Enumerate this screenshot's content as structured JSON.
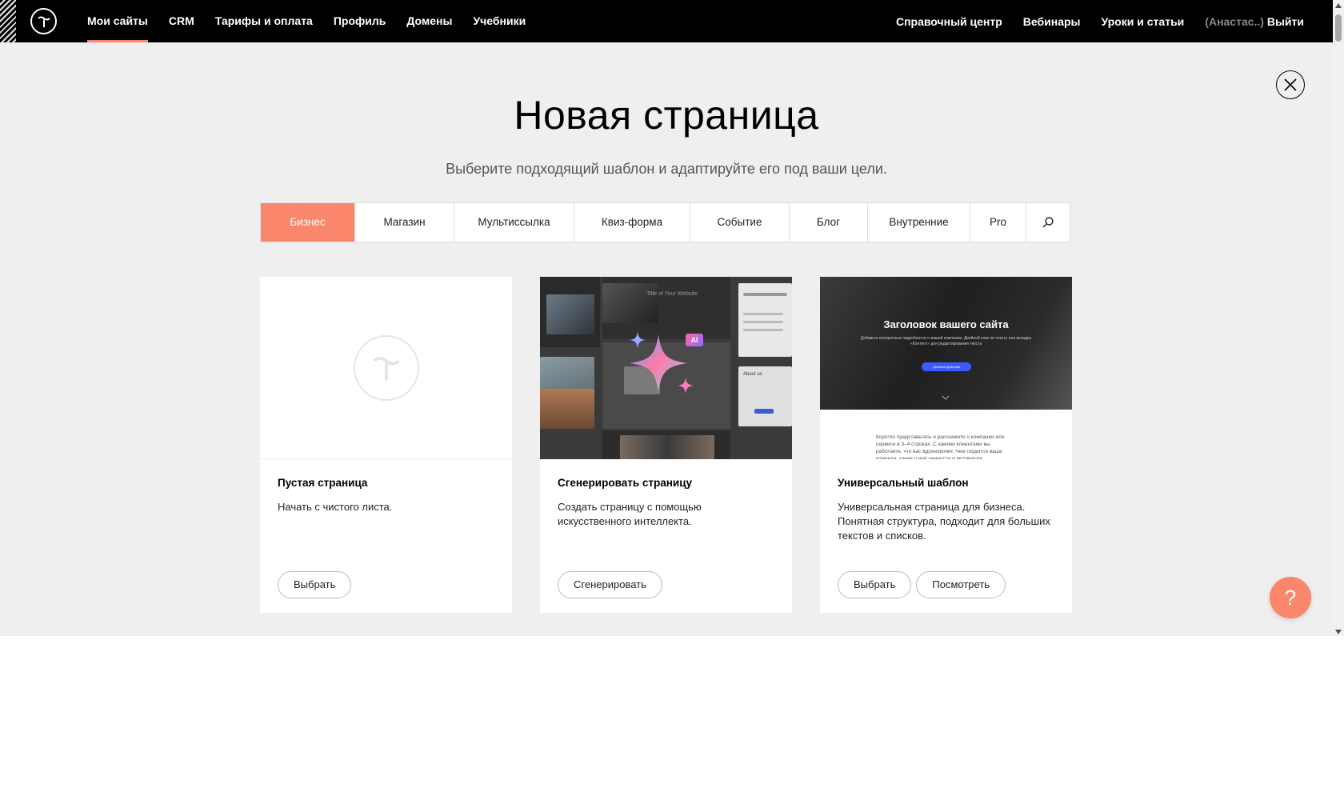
{
  "nav": {
    "left": [
      "Мои сайты",
      "CRM",
      "Тарифы и оплата",
      "Профиль",
      "Домены",
      "Учебники"
    ],
    "active_index": 0,
    "right": [
      "Справочный центр",
      "Вебинары",
      "Уроки и статьи"
    ],
    "user": "(Анастас..)",
    "logout": "Выйти"
  },
  "modal": {
    "title": "Новая страница",
    "subtitle": "Выберите подходящий шаблон и адаптируйте его под ваши цели.",
    "tabs": [
      "Бизнес",
      "Магазин",
      "Мультиссылка",
      "Квиз-форма",
      "Событие",
      "Блог",
      "Внутренние",
      "Pro"
    ],
    "active_tab": 0
  },
  "cards": [
    {
      "title": "Пустая страница",
      "desc": "Начать с чистого листа.",
      "buttons": [
        "Выбрать"
      ]
    },
    {
      "title": "Сгенерировать страницу",
      "desc": "Создать страницу с помощью искусственного интеллекта.",
      "buttons": [
        "Сгенерировать"
      ],
      "preview": {
        "badge": "AI",
        "header": "Title of Your Website",
        "about": "About us"
      }
    },
    {
      "title": "Универсальный шаблон",
      "desc": "Универсальная страница для бизнеса. Понятная структура, подходит для больших текстов и списков.",
      "buttons": [
        "Выбрать",
        "Посмотреть"
      ],
      "preview": {
        "hero_title": "Заголовок вашего сайта",
        "hero_sub": "Добавьте интересные подробности о вашей компании. Двойной клик по тексту или вкладка «Контент» для редактирования текста",
        "hero_button": "Целевое действие",
        "body": "Коротко представьтесь и расскажите о компании или сервисе в 3–4 строках. С какими клиентами вы работаете, что вас вдохновляет. Чем гордится ваша команда, какие у неё ценности и мотивация."
      }
    }
  ],
  "help": "?",
  "colors": {
    "accent": "#fa876b",
    "topbar": "#000000",
    "modal_bg": "#efefef"
  }
}
